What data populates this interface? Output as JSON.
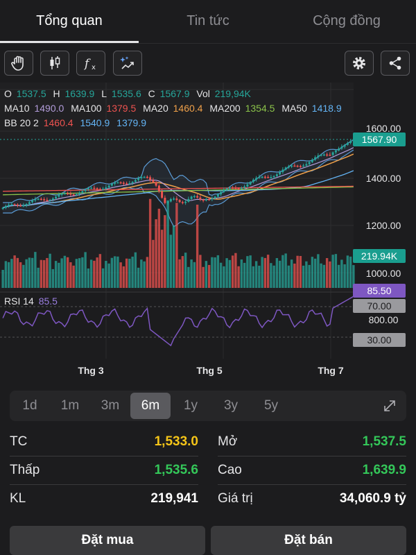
{
  "tabs": [
    {
      "label": "Tổng quan",
      "active": true
    },
    {
      "label": "Tin tức",
      "active": false
    },
    {
      "label": "Cộng đồng",
      "active": false
    }
  ],
  "toolbar": {
    "left_tools": [
      "hand-icon",
      "candlestick-icon",
      "function-icon",
      "magic-trend-icon"
    ],
    "right_tools": [
      "gear-icon",
      "share-icon"
    ]
  },
  "ohlc": {
    "o_label": "O",
    "o_value": "1537.5",
    "h_label": "H",
    "h_value": "1639.9",
    "l_label": "L",
    "l_value": "1535.6",
    "c_label": "C",
    "c_value": "1567.9",
    "vol_label": "Vol",
    "vol_value": "219,94K"
  },
  "ma": {
    "ma10_label": "MA10",
    "ma10_value": "1490.0",
    "ma100_label": "MA100",
    "ma100_value": "1379.5",
    "ma20_label": "MA20",
    "ma20_value": "1460.4",
    "ma200_label": "MA200",
    "ma200_value": "1354.5",
    "ma50_label": "MA50",
    "ma50_value": "1418.9"
  },
  "bb": {
    "label": "BB 20 2",
    "upper": "1460.4",
    "middle": "1540.9",
    "lower": "1379.9"
  },
  "rsi": {
    "label": "RSI 14",
    "value": "85.5"
  },
  "axis_labels": {
    "p1600": "1600.00",
    "p1400": "1400.00",
    "p1200": "1200.00",
    "p1000": "1000.00",
    "p800": "800.00",
    "last_price": "1567.90",
    "volume": "219.94K",
    "rsi_value": "85.50",
    "rsi_70": "70.00",
    "rsi_30": "30.00"
  },
  "x_labels": [
    "Thg 3",
    "Thg 5",
    "Thg 7"
  ],
  "colors": {
    "up": "#26a69a",
    "down": "#ef5350",
    "ma10": "#b39ddb",
    "ma100": "#ef5350",
    "ma20": "#f0a14a",
    "ma200": "#8bc34a",
    "ma50": "#64b5f6",
    "bb": "#5b9bd5",
    "rsi": "#7e57c2",
    "yellow": "#f5c518",
    "green": "#34c759"
  },
  "chart_data": {
    "type": "candlestick",
    "x_ticks": [
      "Thg 3",
      "Thg 5",
      "Thg 7"
    ],
    "y_ticks": [
      1000,
      1200,
      1400,
      1600
    ],
    "last": {
      "open": 1537.5,
      "high": 1639.9,
      "low": 1535.6,
      "close": 1567.9,
      "volume": "219,94K"
    },
    "rsi_levels": [
      30,
      70
    ],
    "rsi_last": 85.5
  },
  "periods": [
    {
      "label": "1d",
      "active": false
    },
    {
      "label": "1m",
      "active": false
    },
    {
      "label": "3m",
      "active": false
    },
    {
      "label": "6m",
      "active": true
    },
    {
      "label": "1y",
      "active": false
    },
    {
      "label": "3y",
      "active": false
    },
    {
      "label": "5y",
      "active": false
    }
  ],
  "stats": {
    "tc_label": "TC",
    "tc_value": "1,533.0",
    "mo_label": "Mở",
    "mo_value": "1,537.5",
    "thap_label": "Thấp",
    "thap_value": "1,535.6",
    "cao_label": "Cao",
    "cao_value": "1,639.9",
    "kl_label": "KL",
    "kl_value": "219,941",
    "giatri_label": "Giá trị",
    "giatri_value": "34,060.9 tỷ"
  },
  "actions": {
    "buy": "Đặt mua",
    "sell": "Đặt bán"
  }
}
